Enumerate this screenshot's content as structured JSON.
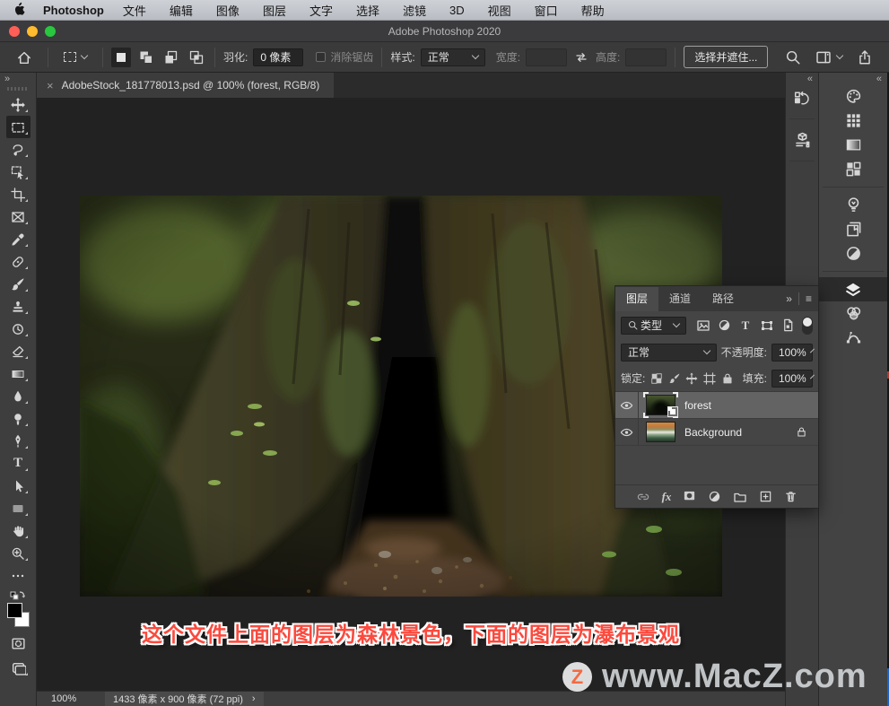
{
  "menubar": {
    "app_name": "Photoshop",
    "items": [
      "文件",
      "编辑",
      "图像",
      "图层",
      "文字",
      "选择",
      "滤镜",
      "3D",
      "视图",
      "窗口",
      "帮助"
    ]
  },
  "titlebar": {
    "title": "Adobe Photoshop 2020"
  },
  "options_bar": {
    "feather_label": "羽化:",
    "feather_value": "0 像素",
    "antialias_label": "消除锯齿",
    "style_label": "样式:",
    "style_value": "正常",
    "width_label": "宽度:",
    "width_value": "",
    "height_label": "高度:",
    "height_value": "",
    "select_and_mask": "选择并遮住..."
  },
  "document": {
    "tab_title": "AdobeStock_181778013.psd @ 100% (forest, RGB/8)"
  },
  "toolbar": {
    "tools": [
      "move",
      "rectangular-marquee",
      "lasso",
      "object-selection",
      "crop",
      "frame",
      "eyedropper",
      "spot-healing-brush",
      "brush",
      "clone-stamp",
      "history-brush",
      "eraser",
      "gradient",
      "blur",
      "dodge",
      "pen",
      "type",
      "path-selection",
      "rectangle",
      "hand",
      "zoom",
      "edit-toolbar"
    ]
  },
  "docks": {
    "narrow_icons": [
      "history",
      "3d"
    ],
    "wide_icons": [
      "color",
      "swatches",
      "gradients",
      "patterns",
      "learn",
      "libraries",
      "adjustments",
      "layers",
      "channels",
      "paths"
    ]
  },
  "layers_panel": {
    "tabs": [
      "图层",
      "通道",
      "路径"
    ],
    "filter_type": "类型",
    "blend_mode": "正常",
    "opacity_label": "不透明度:",
    "opacity_value": "100%",
    "lock_label": "锁定:",
    "fill_label": "填充:",
    "fill_value": "100%",
    "layers": [
      {
        "name": "forest"
      },
      {
        "name": "Background"
      }
    ]
  },
  "status_bar": {
    "zoom": "100%",
    "doc_size": "1433 像素 x 900 像素 (72 ppi)"
  },
  "annotation": {
    "text": "这个文件上面的图层为森林景色，下面的图层为瀑布景观",
    "color": "#fb4a3e"
  },
  "watermark": {
    "badge": "Z",
    "text": "www.MacZ.com",
    "z_color": "#f46a40"
  },
  "icons": {
    "close": "×",
    "toolbar_expand": "»",
    "dock_collapse": "«",
    "panel_expand": "»",
    "panel_menu": "≡",
    "type_tool": "T",
    "fx": "fx",
    "status_chevron": "›"
  }
}
